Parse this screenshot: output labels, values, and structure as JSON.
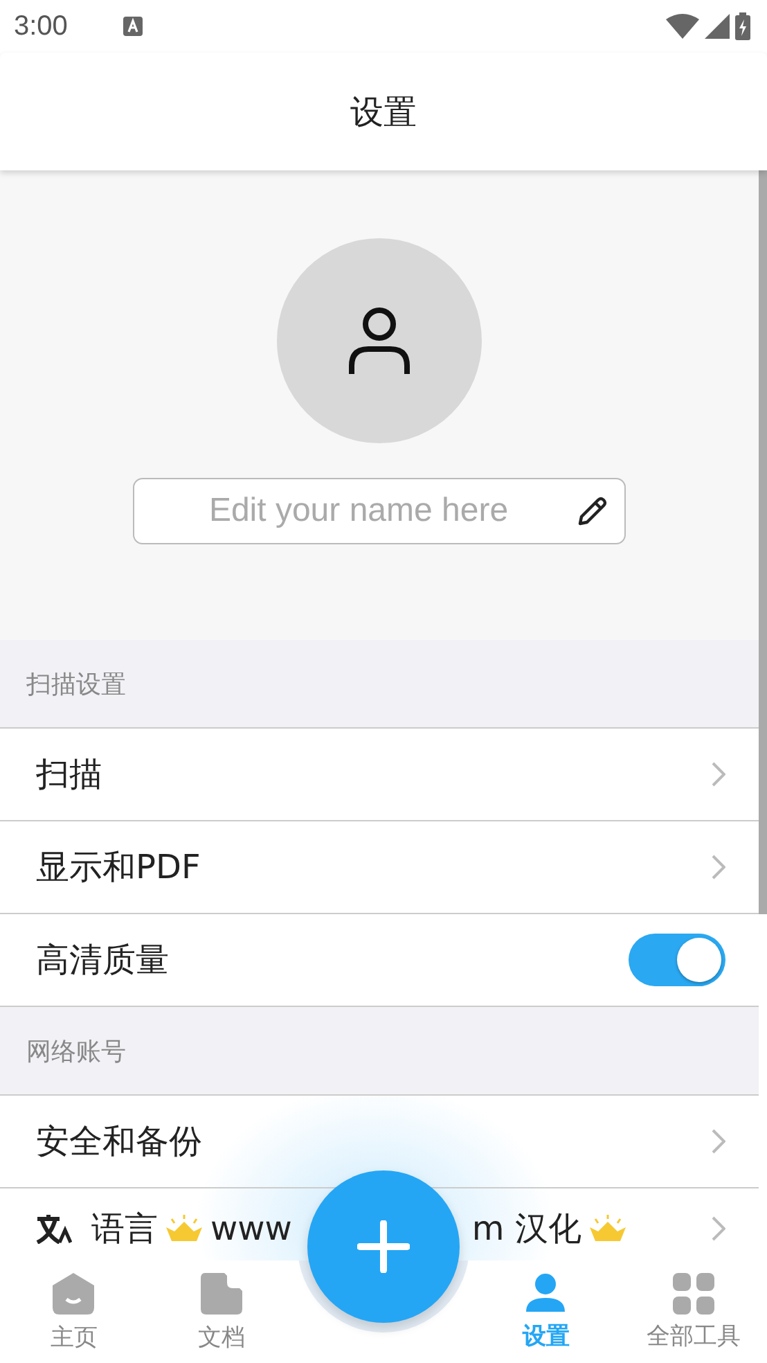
{
  "status_bar": {
    "time": "3:00"
  },
  "header": {
    "title": "设置"
  },
  "profile": {
    "name_field": {
      "placeholder": "Edit your name here"
    }
  },
  "sections": [
    {
      "title": "扫描设置",
      "items": [
        {
          "kind": "link",
          "label": "扫描"
        },
        {
          "kind": "link",
          "label": "显示和PDF"
        },
        {
          "kind": "toggle",
          "label": "高清质量",
          "on": true
        }
      ]
    },
    {
      "title": "网络账号",
      "items": [
        {
          "kind": "link",
          "label": "安全和备份"
        },
        {
          "kind": "language",
          "parts": [
            "语言",
            "www",
            "m 汉化"
          ]
        }
      ]
    }
  ],
  "bottom_nav": [
    {
      "kind": "home",
      "label": "主页",
      "selected": false
    },
    {
      "kind": "document",
      "label": "文档",
      "selected": false
    },
    {
      "kind": "fab"
    },
    {
      "kind": "settings",
      "label": "设置",
      "selected": true
    },
    {
      "kind": "tools",
      "label": "全部工具",
      "selected": false
    }
  ]
}
